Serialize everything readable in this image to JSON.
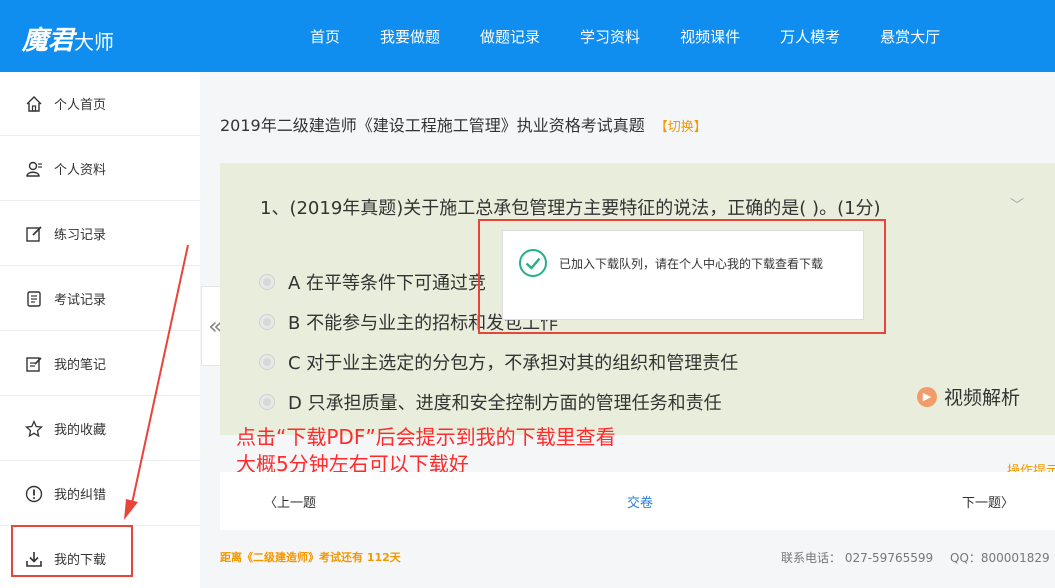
{
  "header": {
    "logo_main": "魔君",
    "logo_suffix": "大师",
    "nav": [
      "首页",
      "我要做题",
      "做题记录",
      "学习资料",
      "视频课件",
      "万人模考",
      "悬赏大厅"
    ]
  },
  "sidebar": {
    "items": [
      {
        "label": "个人首页",
        "icon": "home-icon"
      },
      {
        "label": "个人资料",
        "icon": "profile-icon"
      },
      {
        "label": "练习记录",
        "icon": "edit-icon"
      },
      {
        "label": "考试记录",
        "icon": "document-icon"
      },
      {
        "label": "我的笔记",
        "icon": "note-icon"
      },
      {
        "label": "我的收藏",
        "icon": "star-icon"
      },
      {
        "label": "我的纠错",
        "icon": "alert-icon"
      },
      {
        "label": "我的下载",
        "icon": "download-icon"
      }
    ]
  },
  "exam": {
    "title": "2019年二级建造师《建设工程施工管理》执业资格考试真题",
    "switch_label": "【切换】"
  },
  "question": {
    "text": "1、(2019年真题)关于施工总承包管理方主要特征的说法，正确的是( )。(1分)",
    "options": [
      "A 在平等条件下可通过竞",
      "B 不能参与业主的招标和发包工作",
      "C 对于业主选定的分包方，不承担对其的组织和管理责任",
      "D 只承担质量、进度和安全控制方面的管理任务和责任"
    ],
    "video_label": "视频解析"
  },
  "toast": {
    "message": "已加入下载队列，请在个人中心我的下载查看下载"
  },
  "annotation": {
    "line1": "点击“下载PDF”后会提示到我的下载里查看",
    "line2": "大概5分钟左右可以下载好"
  },
  "ops_hint": "操作提示",
  "bottom": {
    "prev": "上一题",
    "submit": "交卷",
    "next": "下一题"
  },
  "footer": {
    "countdown": "距离《二级建造师》考试还有 112天",
    "phone": "联系电话： 027-59765599",
    "qq": "QQ：800001829"
  },
  "colors": {
    "brand_blue": "#0f8ef0",
    "accent_orange": "#f39800",
    "annotation_red": "#ff2a2a",
    "success_green": "#25b08a"
  }
}
